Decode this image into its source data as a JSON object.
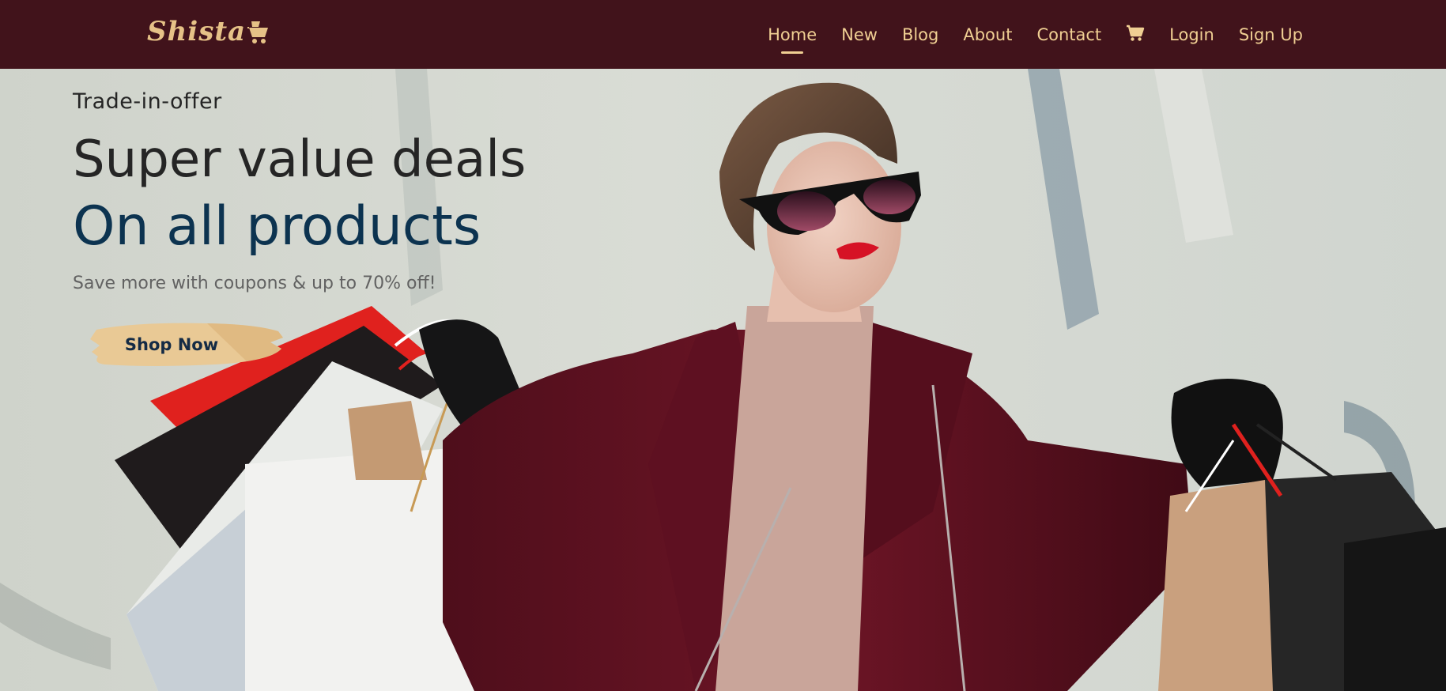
{
  "brand": {
    "name": "Shista",
    "logo_icon": "shopping-cart-icon",
    "colors": {
      "navbar_bg": "#41131b",
      "nav_text": "#f0cf93",
      "accent": "#e6c287"
    }
  },
  "nav": {
    "items": [
      {
        "label": "Home",
        "active": true
      },
      {
        "label": "New"
      },
      {
        "label": "Blog"
      },
      {
        "label": "About"
      },
      {
        "label": "Contact"
      }
    ],
    "cart_icon": "cart-icon",
    "login_label": "Login",
    "signup_label": "Sign Up"
  },
  "hero": {
    "eyebrow": "Trade-in-offer",
    "headline": "Super value deals",
    "subheadline": "On all products",
    "note": "Save more with coupons & up to 70% off!",
    "cta_label": "Shop Now",
    "colors": {
      "headline": "#252525",
      "subheadline": "#0c3350",
      "cta_bg": "#e9c995"
    }
  }
}
